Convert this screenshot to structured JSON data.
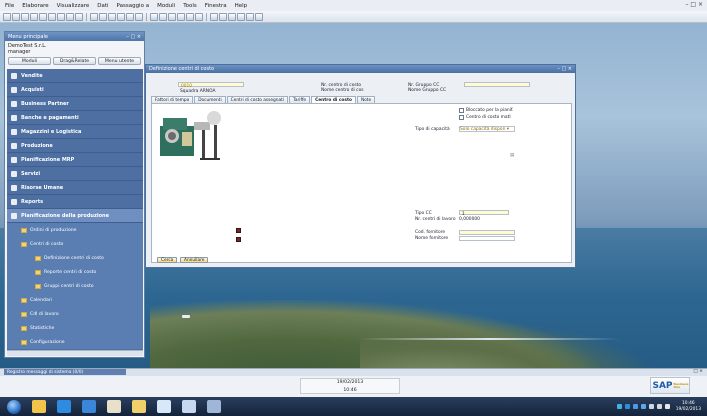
{
  "menubar": {
    "items": [
      "File",
      "Elaborare",
      "Visualizzare",
      "Dati",
      "Passaggio a",
      "Moduli",
      "Tools",
      "Finestra",
      "Help"
    ]
  },
  "main_menu": {
    "title": "Menu principale",
    "company": "DemoTest S.r.L.",
    "user": "manager",
    "tabs": [
      "Moduli",
      "Drag&Relate",
      "Menu utente"
    ],
    "items": [
      {
        "label": "Vendite",
        "icon": "cart-icon"
      },
      {
        "label": "Acquisti",
        "icon": "purchase-icon"
      },
      {
        "label": "Business Partner",
        "icon": "people-icon"
      },
      {
        "label": "Banche e pagamenti",
        "icon": "bank-icon"
      },
      {
        "label": "Magazzini e Logistica",
        "icon": "warehouse-icon"
      },
      {
        "label": "Produzione",
        "icon": "gear-icon"
      },
      {
        "label": "Pianificazione MRP",
        "icon": "plan-icon"
      },
      {
        "label": "Servizi",
        "icon": "wrench-icon"
      },
      {
        "label": "Risorse Umane",
        "icon": "person-icon"
      },
      {
        "label": "Reports",
        "icon": "report-icon"
      },
      {
        "label": "Pianificazione della produzione",
        "icon": "production-plan-icon"
      }
    ],
    "subitems": [
      {
        "label": "Ordini di produzione",
        "level": 1
      },
      {
        "label": "Centri di costo",
        "level": 1
      },
      {
        "label": "Definizione centri di costo",
        "level": 2
      },
      {
        "label": "Reporte centri di costo",
        "level": 2
      },
      {
        "label": "Gruppi centri di costo",
        "level": 2
      },
      {
        "label": "Calendari",
        "level": 1
      },
      {
        "label": "Cdl di lavoro",
        "level": 1
      },
      {
        "label": "Statistiche",
        "level": 1
      },
      {
        "label": "Configurazione",
        "level": 1
      }
    ]
  },
  "window": {
    "title": "Definizione centri di costo",
    "code_value": "0010",
    "desc_value": "Squadra ARNOA",
    "label_nr_centro": "Nr. centro di costo",
    "label_nome_centro": "Nome centro di cos",
    "label_nr_gruppo": "Nr. Gruppo CC",
    "label_nome_gruppo": "Nome Gruppo CC",
    "tabs": [
      "Fattori di tempo",
      "Documenti",
      "Centri di costo assegnati",
      "Tariffe",
      "Centro di costo",
      "Note"
    ],
    "active_tab": 4,
    "chk_bloccato": "Bloccato per la pianif.",
    "chk_centro_mat": "Centro di costo matl",
    "label_tipo_capacita": "Tipo di capacità",
    "val_tipo_capacita": "Solo capacità dispon",
    "label_tipo_cc": "Tipo CC",
    "val_tipo_cc": "1",
    "label_nr_centri_lavoro": "Nr. centri di lavoro",
    "val_nr_centri_lavoro": "0,000000",
    "label_cod_fornitore": "Cod. fornitore",
    "label_nome_fornitore": "Nome fornitore",
    "btn_cerca": "Cerca",
    "btn_annullare": "Annullare"
  },
  "message_bar": {
    "title": "Registro messaggi di sistema (0/0)"
  },
  "status": {
    "date": "19/02/2013",
    "time": "10:46"
  },
  "brand": {
    "logo": "SAP",
    "logo_suffix": "Business One"
  },
  "taskbar": {
    "clock_time": "10:46",
    "clock_date": "19/02/2013"
  }
}
